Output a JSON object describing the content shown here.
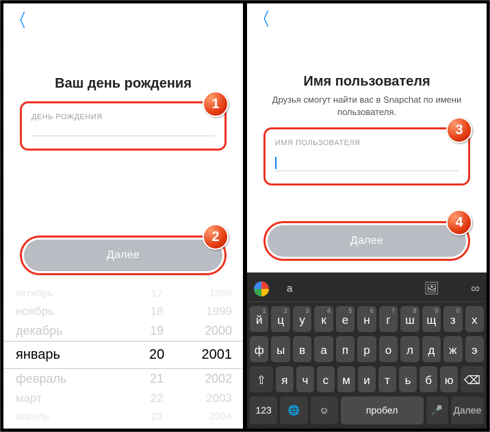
{
  "left": {
    "title": "Ваш день рождения",
    "input_label": "ДЕНЬ РОЖДЕНИЯ",
    "button": "Далее",
    "badge_input": "1",
    "badge_button": "2",
    "picker": {
      "rows": [
        {
          "m": "октябрь",
          "d": "17",
          "y": "1998"
        },
        {
          "m": "ноябрь",
          "d": "18",
          "y": "1999"
        },
        {
          "m": "декабрь",
          "d": "19",
          "y": "2000"
        },
        {
          "m": "январь",
          "d": "20",
          "y": "2001"
        },
        {
          "m": "февраль",
          "d": "21",
          "y": "2002"
        },
        {
          "m": "март",
          "d": "22",
          "y": "2003"
        },
        {
          "m": "апрель",
          "d": "23",
          "y": "2004"
        }
      ],
      "selected_index": 3
    }
  },
  "right": {
    "title": "Имя пользователя",
    "subtitle": "Друзья смогут найти вас в Snapchat по имени пользователя.",
    "input_label": "ИМЯ ПОЛЬЗОВАТЕЛЯ",
    "button": "Далее",
    "badge_input": "3",
    "badge_button": "4",
    "keyboard": {
      "suggestion": "а",
      "row1": [
        "й",
        "ц",
        "у",
        "к",
        "е",
        "н",
        "г",
        "ш",
        "щ",
        "з",
        "х"
      ],
      "row1_sup": [
        "1",
        "2",
        "3",
        "4",
        "5",
        "6",
        "7",
        "8",
        "9",
        "0",
        ""
      ],
      "row2": [
        "ф",
        "ы",
        "в",
        "а",
        "п",
        "р",
        "о",
        "л",
        "д",
        "ж",
        "э"
      ],
      "row3": [
        "я",
        "ч",
        "с",
        "м",
        "и",
        "т",
        "ь",
        "б",
        "ю"
      ],
      "shift": "⇧",
      "back": "⌫",
      "num": "123",
      "globe": "🌐",
      "emoji": "☺",
      "space": "пробел",
      "mic": "🎤",
      "next": "Далее"
    }
  }
}
